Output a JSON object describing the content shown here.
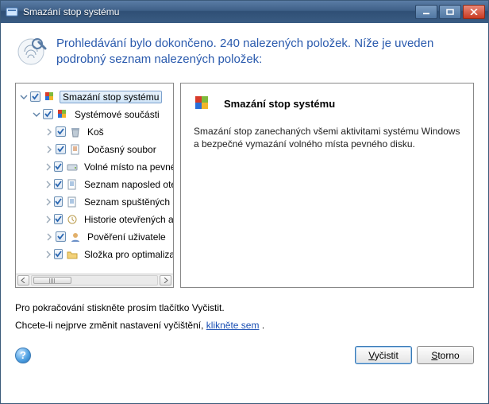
{
  "window": {
    "title": "Smazání stop systému"
  },
  "header": {
    "line": "Prohledávání bylo dokončeno. 240 nalezených položek. Níže je uveden podrobný seznam nalezených položek:"
  },
  "tree": {
    "root": {
      "label": "Smazání stop systému"
    },
    "group": {
      "label": "Systémové součásti"
    },
    "items": [
      {
        "label": "Koš",
        "icon": "trash"
      },
      {
        "label": "Dočasný soubor",
        "icon": "tempfile"
      },
      {
        "label": "Volné místo na pevném disku",
        "icon": "disk"
      },
      {
        "label": "Seznam naposled otevřených",
        "icon": "recent"
      },
      {
        "label": "Seznam spuštěných aplikací",
        "icon": "recent"
      },
      {
        "label": "Historie otevřených aplikací",
        "icon": "history"
      },
      {
        "label": "Pověření uživatele",
        "icon": "user"
      },
      {
        "label": "Složka pro optimalizaci",
        "icon": "folder"
      }
    ]
  },
  "detail": {
    "title": "Smazání stop systému",
    "body": "Smazání stop zanechaných všemi aktivitami systému Windows a bezpečné vymazání volného místa pevného disku."
  },
  "footer": {
    "line1": "Pro pokračování stiskněte prosím tlačítko Vyčistit.",
    "line2_prefix": "Chcete-li nejprve změnit nastavení vyčištění, ",
    "line2_link": "klikněte sem",
    "line2_suffix": " ."
  },
  "buttons": {
    "clean": "Vyčistit",
    "cancel": "Storno",
    "help": "?"
  }
}
